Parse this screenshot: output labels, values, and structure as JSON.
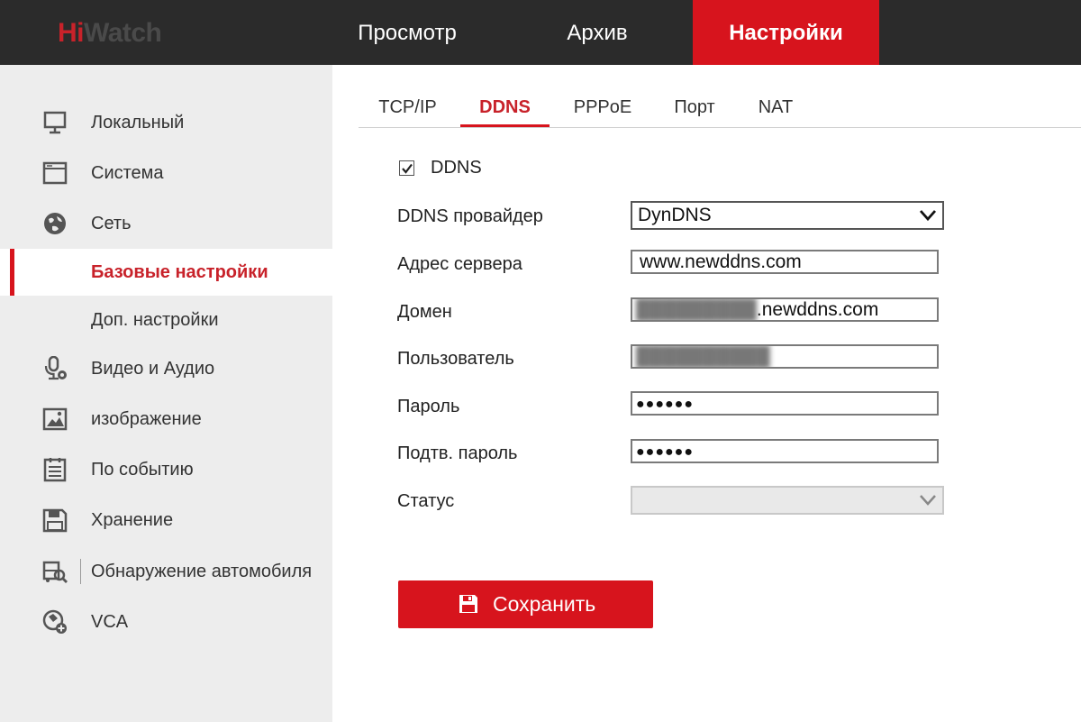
{
  "brand": {
    "hi": "Hi",
    "watch": "Watch"
  },
  "nav": {
    "view": "Просмотр",
    "archive": "Архив",
    "settings": "Настройки"
  },
  "sidebar": {
    "items": [
      {
        "label": "Локальный",
        "icon": "monitor-icon"
      },
      {
        "label": "Система",
        "icon": "window-icon"
      },
      {
        "label": "Сеть",
        "icon": "globe-icon"
      },
      {
        "label": "Базовые настройки",
        "active": true
      },
      {
        "label": "Доп. настройки"
      },
      {
        "label": "Видео и Аудио",
        "icon": "microphone-camera-icon"
      },
      {
        "label": "изображение",
        "icon": "image-icon"
      },
      {
        "label": "По событию",
        "icon": "event-list-icon"
      },
      {
        "label": "Хранение",
        "icon": "floppy-icon"
      },
      {
        "label": "Обнаружение автомобиля",
        "icon": "vehicle-search-icon"
      },
      {
        "label": "VCA",
        "icon": "vca-icon"
      }
    ]
  },
  "tabs": [
    "TCP/IP",
    "DDNS",
    "PPPoE",
    "Порт",
    "NAT"
  ],
  "active_tab": "DDNS",
  "form": {
    "enable_label": "DDNS",
    "enabled": true,
    "provider_label": "DDNS провайдер",
    "provider_value": "DynDNS",
    "server_label": "Адрес сервера",
    "server_value": "www.newddns.com",
    "domain_label": "Домен",
    "domain_suffix": ".newddns.com",
    "user_label": "Пользователь",
    "password_label": "Пароль",
    "password_value": "●●●●●●",
    "confirm_label": "Подтв. пароль",
    "confirm_value": "●●●●●●",
    "status_label": "Статус",
    "status_value": ""
  },
  "save_button": {
    "label": "Сохранить",
    "icon": "floppy-icon"
  },
  "colors": {
    "accent": "#d7141d",
    "topbar": "#2b2b2b",
    "sidebar": "#ededed"
  }
}
